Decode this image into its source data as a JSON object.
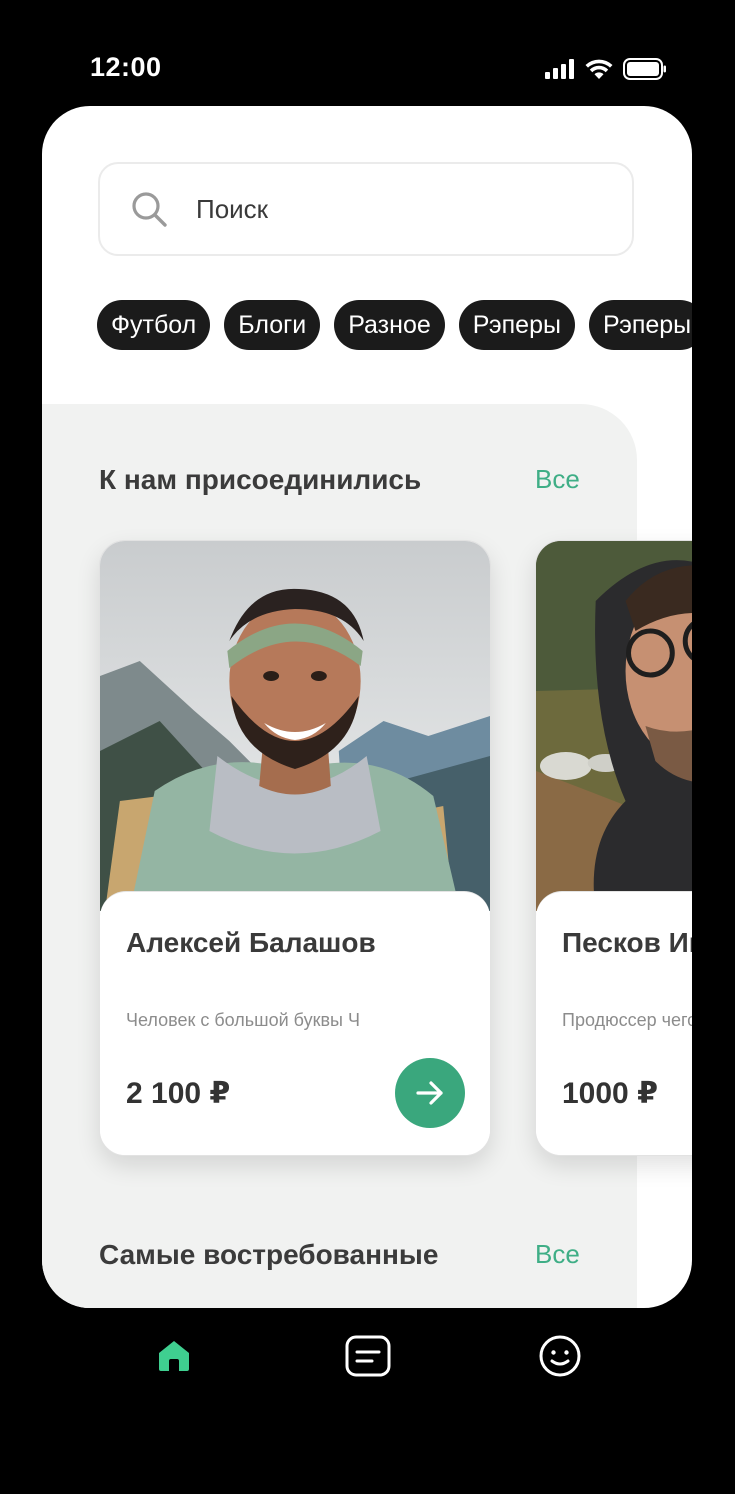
{
  "status_bar": {
    "time": "12:00"
  },
  "search": {
    "placeholder": "Поиск"
  },
  "categories": [
    "Футбол",
    "Блоги",
    "Разное",
    "Рэперы",
    "Рэперы"
  ],
  "joined_section": {
    "title": "К нам присоединились",
    "see_all": "Все",
    "cards": [
      {
        "name": "Алексей Балашов",
        "description": "Человек с большой буквы Ч",
        "price": "2 100 ₽"
      },
      {
        "name": "Песков Иван",
        "description": "Продюссер чего-то",
        "price": "1000 ₽"
      }
    ]
  },
  "popular_section": {
    "title": "Самые востребованные",
    "see_all": "Все"
  },
  "tabbar": {
    "items": [
      "home-icon",
      "chat-icon",
      "profile-icon"
    ],
    "active_color": "#3fcf90",
    "inactive_color": "#ffffff"
  },
  "colors": {
    "accent": "#3aa77d",
    "section_bg": "#f1f2f1",
    "chip_bg": "#1b1b1b"
  }
}
